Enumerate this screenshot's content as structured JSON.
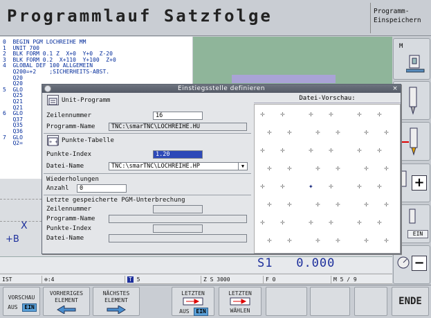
{
  "header": {
    "title": "Programmlauf Satzfolge",
    "mode_lines": [
      "Programm-",
      "Einspeichern"
    ]
  },
  "listing": {
    "lines": [
      "0  BEGIN PGM LOCHREIHE MM",
      "1  UNIT 700",
      "2  BLK FORM 0.1 Z  X+0  Y+0  Z-20",
      "3  BLK FORM 0.2  X+110  Y+100  Z+0",
      "4  GLOBAL DEF 100 ALLGEMEIN",
      "   Q200=+2    ;SICHERHEITS-ABST.",
      "   Q20",
      "   Q20",
      "5  GLO",
      "   Q25",
      "   Q21",
      "   Q21",
      "6  GLO",
      "   Q37",
      "   Q35",
      "   Q36",
      "7  GLO",
      "   Q2="
    ]
  },
  "dialog": {
    "title": "Einstiegsstelle definieren",
    "close": "×",
    "section_unit": "Unit-Programm",
    "zeilennummer_label": "Zeilennummer",
    "zeilennummer_value": "16",
    "programmname_label": "Programm-Name",
    "programmname_value": "TNC:\\smarTNC\\LOCHREIHE.HU",
    "section_punkte": "Punkte-Tabelle",
    "punkteindex_label": "Punkte-Index",
    "punkteindex_value": "1.20",
    "dateiname_label": "Datei-Name",
    "dateiname_value": "TNC:\\smarTNC\\LOCHREIHE.HP",
    "wiederholungen_label": "Wiederholungen",
    "anzahl_label": "Anzahl",
    "anzahl_value": "0",
    "pgm_label": "Letzte gespeicherte PGM-Unterbrechung",
    "zeilennummer2_label": "Zeilennummer",
    "programmname2_label": "Programm-Name",
    "punkteindex2_label": "Punkte-Index",
    "dateiname2_label": "Datei-Name",
    "preview_label": "Datei-Vorschau:"
  },
  "preview_points": {
    "rows": 8,
    "cols": 6,
    "selected_row": 4,
    "selected_col": 2
  },
  "lower": {
    "x_label": "X",
    "b_label": "+B"
  },
  "status": {
    "s1": "S1",
    "value": "0.000",
    "ist": "IST",
    "t4": "4",
    "t_tool": "5",
    "zs": "Z S 3000",
    "f": "F 0",
    "m": "M 5 / 9"
  },
  "right_keys": {
    "m": "M",
    "ein": "EIN",
    "pct": "%"
  },
  "softkeys": {
    "vorschau": "VORSCHAU",
    "aus": "AUS",
    "ein": "EIN",
    "vorheriges": [
      "VORHERIGES",
      "ELEMENT"
    ],
    "naechstes": [
      "NÄCHSTES",
      "ELEMENT"
    ],
    "letzten1": "LETZTEN",
    "letzten2": "LETZTEN",
    "waehlen": "WÄHLEN",
    "ende": "ENDE"
  }
}
